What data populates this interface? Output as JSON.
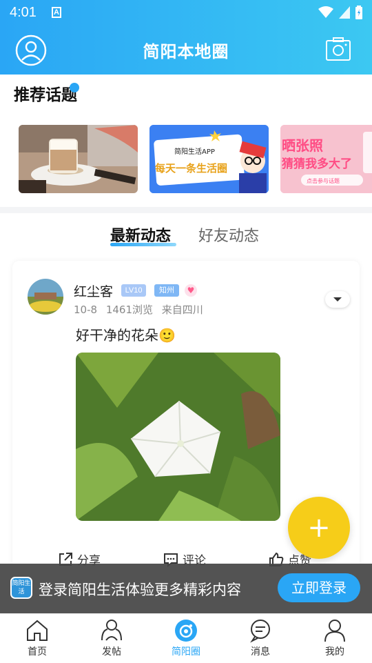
{
  "status_bar": {
    "time": "4:01",
    "a_label": "A"
  },
  "header": {
    "title": "简阳本地圈"
  },
  "recommend": {
    "title": "推荐话题",
    "cards": [
      {
        "name": "topic-card-coffee",
        "image": "coffee-cup-photo"
      },
      {
        "name": "topic-card-app",
        "text_line1": "简阳生活APP",
        "text_line2": "每天一条生活圈"
      },
      {
        "name": "topic-card-photo",
        "text_line1": "晒张照",
        "text_line2": "猜猜我多大了",
        "button": "点击参与话题"
      }
    ]
  },
  "tabs": [
    {
      "label": "最新动态"
    },
    {
      "label": "好友动态"
    }
  ],
  "post": {
    "username": "红尘客",
    "level": "LV10",
    "tag": "知州",
    "date": "10-8",
    "views": "1461浏览",
    "location": "来自四川",
    "text": "好干净的花朵",
    "emoji": "🙂",
    "actions": {
      "share": "分享",
      "comment": "评论",
      "like": "点赞"
    }
  },
  "fab": {
    "label": "+"
  },
  "login_banner": {
    "logo_text": "简阳生活",
    "message": "登录简阳生活体验更多精彩内容",
    "button": "立即登录"
  },
  "nav": [
    {
      "label": "首页",
      "icon": "home-icon"
    },
    {
      "label": "发帖",
      "icon": "post-icon"
    },
    {
      "label": "简阳圈",
      "icon": "circle-icon",
      "active": true
    },
    {
      "label": "消息",
      "icon": "message-icon"
    },
    {
      "label": "我的",
      "icon": "profile-icon"
    }
  ],
  "colors": {
    "primary": "#2aa6f5",
    "fab": "#f6cd19"
  }
}
